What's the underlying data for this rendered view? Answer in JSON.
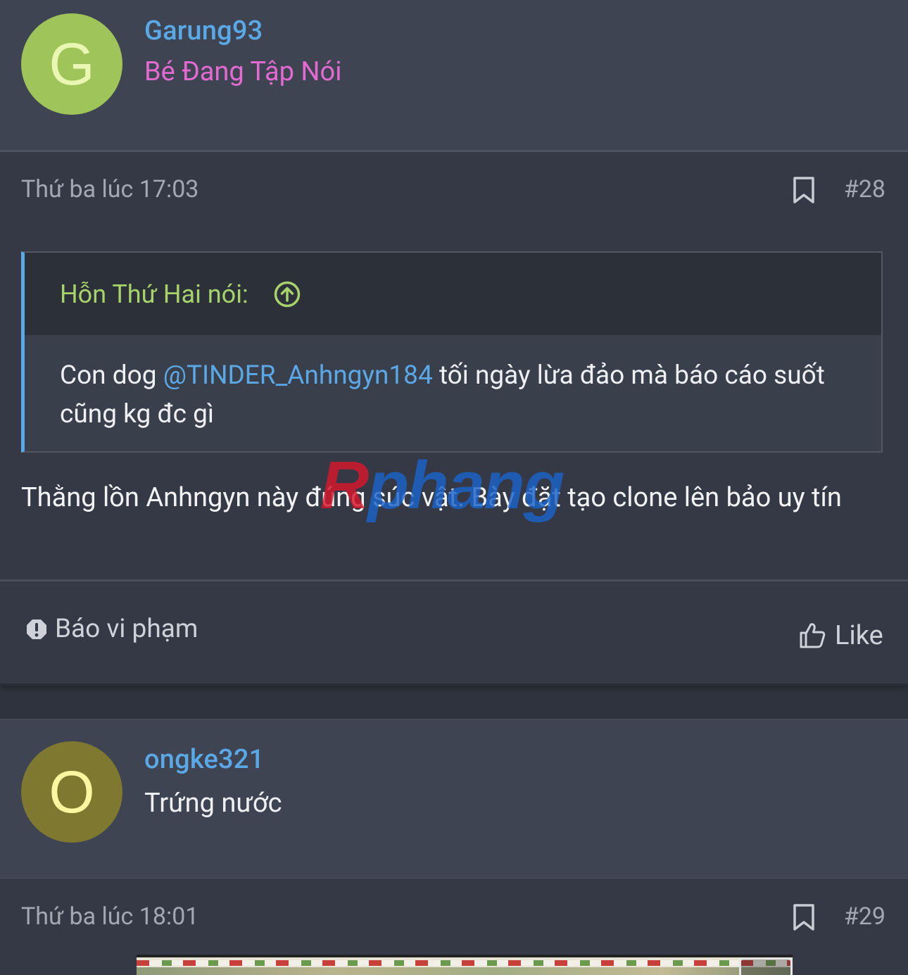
{
  "posts": [
    {
      "avatar_letter": "G",
      "username": "Garung93",
      "user_title": "Bé Đang Tập Nói",
      "date": "Thứ ba lúc 17:03",
      "post_number": "#28",
      "quote": {
        "author_label": "Hỗn Thứ Hai nói:",
        "text_before": "Con dog ",
        "mention": "@TINDER_Anhngyn184",
        "text_after": " tối ngày lừa đảo mà báo cáo suốt cũng kg đc gì"
      },
      "message": "Thằng lồn Anhngyn này đúng súc vật. Bày đặt tạo clone lên bảo uy tín",
      "report_label": "Báo vi phạm",
      "like_label": "Like"
    },
    {
      "avatar_letter": "O",
      "username": "ongke321",
      "user_title": "Trứng nước",
      "date": "Thứ ba lúc 18:01",
      "post_number": "#29"
    }
  ],
  "watermark": {
    "first_letter": "R",
    "rest": "phang"
  },
  "colors": {
    "background": "#2f333d",
    "username": "#5aa8e6",
    "title_pink": "#e36ad1",
    "quote_author": "#a8d26a",
    "avatar_g": "#9fc45a",
    "avatar_o": "#7f7830"
  },
  "icons": [
    "bookmark-icon",
    "arrow-up-circle-icon",
    "alert-icon",
    "thumbs-up-icon"
  ]
}
